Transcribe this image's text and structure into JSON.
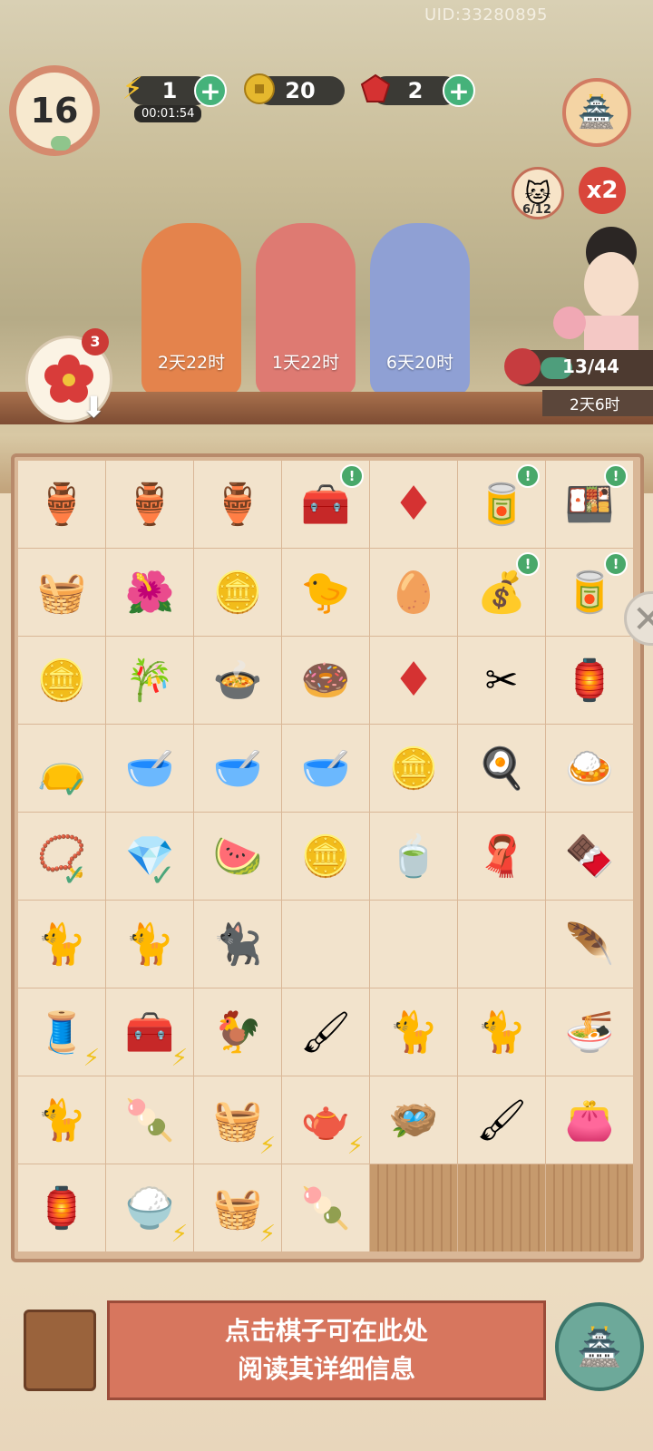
{
  "uid": "UID:33280895",
  "level": "16",
  "resources": {
    "energy": "1",
    "energy_timer": "00:01:54",
    "coins": "20",
    "gems": "2"
  },
  "cat_counter": "6/12",
  "multiplier": "x2",
  "events": [
    {
      "label": "2天22时",
      "color": "#e4834c"
    },
    {
      "label": "1天22时",
      "color": "#de7a72"
    },
    {
      "label": "6天20时",
      "color": "#8fa0d4"
    }
  ],
  "flower_badge": "3",
  "progress": {
    "text": "13/44",
    "fraction": 0.295,
    "timer": "2天6时"
  },
  "info_text": {
    "line1": "点击棋子可在此处",
    "line2": "阅读其详细信息"
  },
  "board": {
    "rows": [
      [
        "gourd-bolt",
        "gourd-bolt-gold",
        "gourd-bolt-purple",
        "chest-blue",
        "ruby-pair",
        "red-tin",
        "offering-tray"
      ],
      [
        "basket",
        "red-flowers",
        "coin-stack",
        "chick-nest",
        "egg-nest",
        "coin-pouch",
        "green-tin"
      ],
      [
        "coins",
        "bamboo",
        "soup-bowl",
        "donut-plate",
        "ruby",
        "scissors",
        "lantern"
      ],
      [
        "purple-bag",
        "porridge",
        "green-soup",
        "dessert-bowl",
        "coin",
        "fried-egg",
        "fried-rice"
      ],
      [
        "bracelet",
        "earrings",
        "watermelon",
        "coin-pile",
        "tea-bowl",
        "purple-cloth",
        "cake-box"
      ],
      [
        "tuxedo-cat",
        "tabby-cat",
        "black-cat",
        "empty",
        "empty",
        "empty",
        "feather"
      ],
      [
        "thread-spool",
        "treasure-chest",
        "rooster-nest",
        "brush-ruler",
        "sleeping-cat",
        "calico-cat",
        "bowl-dish"
      ],
      [
        "orange-cat",
        "bunny-cake-bowl",
        "fruit-basket",
        "teapot",
        "cage",
        "brush",
        "purple-pouch"
      ],
      [
        "lantern-stand",
        "flour-bowl",
        "weave-basket",
        "bunny-bowl",
        "locked-slats",
        "locked-slats",
        "locked-slats"
      ]
    ]
  }
}
